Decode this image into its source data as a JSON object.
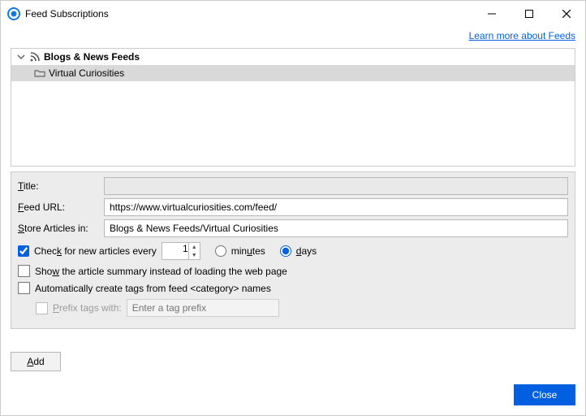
{
  "window": {
    "title": "Feed Subscriptions"
  },
  "link": {
    "learn_more": "Learn more about Feeds"
  },
  "tree": {
    "root": "Blogs & News Feeds",
    "selected": "Virtual Curiosities"
  },
  "form": {
    "title_label": "Title:",
    "title_value": "",
    "feedurl_label": "Feed URL:",
    "feedurl_value": "https://www.virtualcuriosities.com/feed/",
    "store_label": "Store Articles in:",
    "store_value": "Blogs & News Feeds/Virtual Curiosities",
    "check_label": "Check for new articles every",
    "check_value": "1",
    "minutes_label": "minutes",
    "days_label": "days",
    "summary_label": "Show the article summary instead of loading the web page",
    "autotag_label": "Automatically create tags from feed <category> names",
    "prefix_label": "Prefix tags with:",
    "prefix_placeholder": "Enter a tag prefix"
  },
  "buttons": {
    "add": "Add",
    "close": "Close"
  }
}
